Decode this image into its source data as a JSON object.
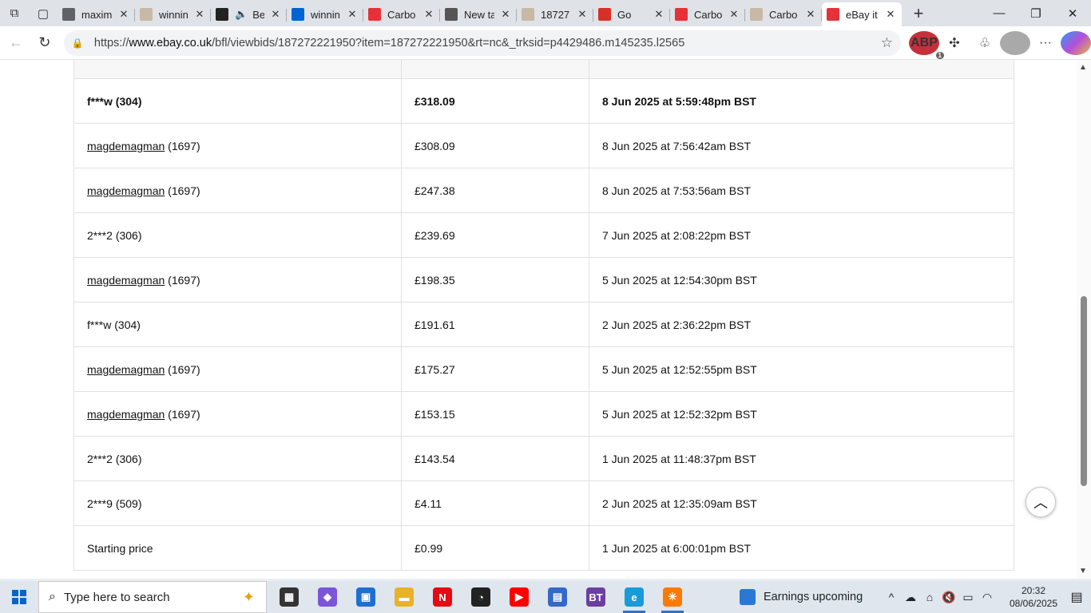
{
  "browser": {
    "tabs": [
      {
        "title": "maxim",
        "favicon": "search-icon",
        "color": "#5f6368"
      },
      {
        "title": "winnin",
        "favicon": "page-icon",
        "color": "#c8b8a6"
      },
      {
        "title": "Be",
        "favicon": "panda-icon",
        "color": "#222222",
        "audio": true
      },
      {
        "title": "winnin",
        "favicon": "ebay-icon",
        "color": "#0064d2"
      },
      {
        "title": "Carbo",
        "favicon": "ebay-icon",
        "color": "#e53238"
      },
      {
        "title": "New ta",
        "favicon": "newtab-icon",
        "color": "#555555"
      },
      {
        "title": "18727",
        "favicon": "page-icon",
        "color": "#c8b8a6"
      },
      {
        "title": "Go",
        "favicon": "gmail-icon",
        "color": "#d93025"
      },
      {
        "title": "Carbo",
        "favicon": "ebay-icon",
        "color": "#e53238"
      },
      {
        "title": "Carbo",
        "favicon": "page-icon",
        "color": "#c8b8a6"
      },
      {
        "title": "eBay it",
        "favicon": "ebay-icon",
        "color": "#e53238",
        "active": true
      }
    ],
    "url_prefix": "https://",
    "url_host": "www.ebay.co.uk",
    "url_path": "/bfl/viewbids/187272221950?item=187272221950&rt=nc&_trksid=p4429486.m145235.l2565",
    "extension_badge": "ABP",
    "extension_badge_count": "1"
  },
  "bid_history": {
    "rows": [
      {
        "bidder": "f***w",
        "feedback": "(304)",
        "amount": "£318.09",
        "time": "8 Jun 2025 at 5:59:48pm BST",
        "link": false,
        "top": true
      },
      {
        "bidder": "magdemagman",
        "feedback": "(1697)",
        "amount": "£308.09",
        "time": "8 Jun 2025 at 7:56:42am BST",
        "link": true
      },
      {
        "bidder": "magdemagman",
        "feedback": "(1697)",
        "amount": "£247.38",
        "time": "8 Jun 2025 at 7:53:56am BST",
        "link": true
      },
      {
        "bidder": "2***2",
        "feedback": "(306)",
        "amount": "£239.69",
        "time": "7 Jun 2025 at 2:08:22pm BST",
        "link": false
      },
      {
        "bidder": "magdemagman",
        "feedback": "(1697)",
        "amount": "£198.35",
        "time": "5 Jun 2025 at 12:54:30pm BST",
        "link": true
      },
      {
        "bidder": "f***w",
        "feedback": "(304)",
        "amount": "£191.61",
        "time": "2 Jun 2025 at 2:36:22pm BST",
        "link": false
      },
      {
        "bidder": "magdemagman",
        "feedback": "(1697)",
        "amount": "£175.27",
        "time": "5 Jun 2025 at 12:52:55pm BST",
        "link": true
      },
      {
        "bidder": "magdemagman",
        "feedback": "(1697)",
        "amount": "£153.15",
        "time": "5 Jun 2025 at 12:52:32pm BST",
        "link": true
      },
      {
        "bidder": "2***2",
        "feedback": "(306)",
        "amount": "£143.54",
        "time": "1 Jun 2025 at 11:48:37pm BST",
        "link": false
      },
      {
        "bidder": "2***9",
        "feedback": "(509)",
        "amount": "£4.11",
        "time": "2 Jun 2025 at 12:35:09am BST",
        "link": false
      }
    ],
    "starting": {
      "label": "Starting price",
      "amount": "£0.99",
      "time": "1 Jun 2025 at 6:00:01pm BST"
    }
  },
  "taskbar": {
    "search_placeholder": "Type here to search",
    "apps": [
      {
        "name": "task-view",
        "color": "#333333",
        "glyph": "▦"
      },
      {
        "name": "copilot",
        "color": "#7a55d8",
        "glyph": "◆"
      },
      {
        "name": "store",
        "color": "#1f6fd1",
        "glyph": "▣"
      },
      {
        "name": "file-explorer",
        "color": "#e8b32a",
        "glyph": "▬"
      },
      {
        "name": "netflix",
        "color": "#e50914",
        "glyph": "N"
      },
      {
        "name": "speedtest",
        "color": "#222222",
        "glyph": "◔"
      },
      {
        "name": "youtube",
        "color": "#ff0000",
        "glyph": "▶"
      },
      {
        "name": "shopping-bag",
        "color": "#3569c9",
        "glyph": "▤"
      },
      {
        "name": "bt-app",
        "color": "#6b3fa0",
        "glyph": "BT"
      },
      {
        "name": "edge",
        "color": "#1a9ad9",
        "glyph": "e",
        "active": true
      },
      {
        "name": "avast",
        "color": "#ff7800",
        "glyph": "✳",
        "active": true
      }
    ],
    "widget_text": "Earnings upcoming",
    "time": "20:32",
    "date": "08/06/2025"
  }
}
